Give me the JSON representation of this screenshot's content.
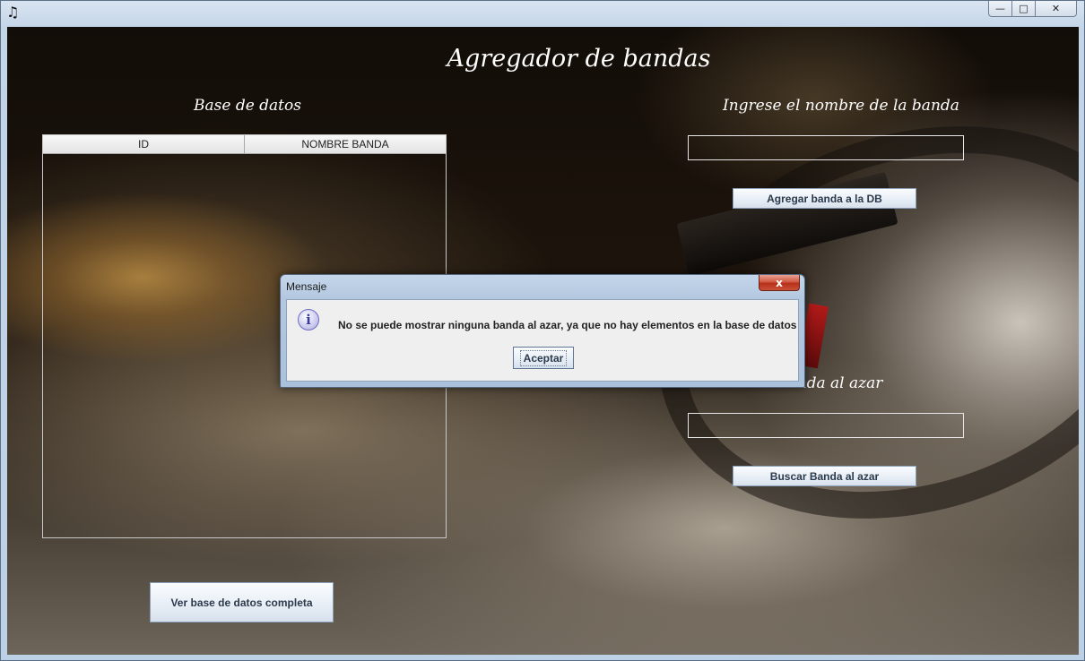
{
  "window": {
    "app_icon": "♫",
    "min_glyph": "—",
    "max_glyph": "□",
    "close_glyph": "✕"
  },
  "app": {
    "title": "Agregador de bandas",
    "db_label": "Base de datos",
    "name_label": "Ingrese el nombre de la banda",
    "random_label": "Banda al azar",
    "add_button": "Agregar banda a la DB",
    "random_button": "Buscar Banda al azar",
    "view_button": "Ver base de datos completa",
    "name_value": "",
    "random_value": ""
  },
  "table": {
    "columns": [
      "ID",
      "NOMBRE BANDA"
    ],
    "rows": []
  },
  "dialog": {
    "title": "Mensaje",
    "message": "No se puede mostrar ninguna banda al azar, ya que no hay elementos en la base de datos",
    "ok_label": "Aceptar",
    "close_glyph": "x",
    "icon": "info-icon"
  }
}
